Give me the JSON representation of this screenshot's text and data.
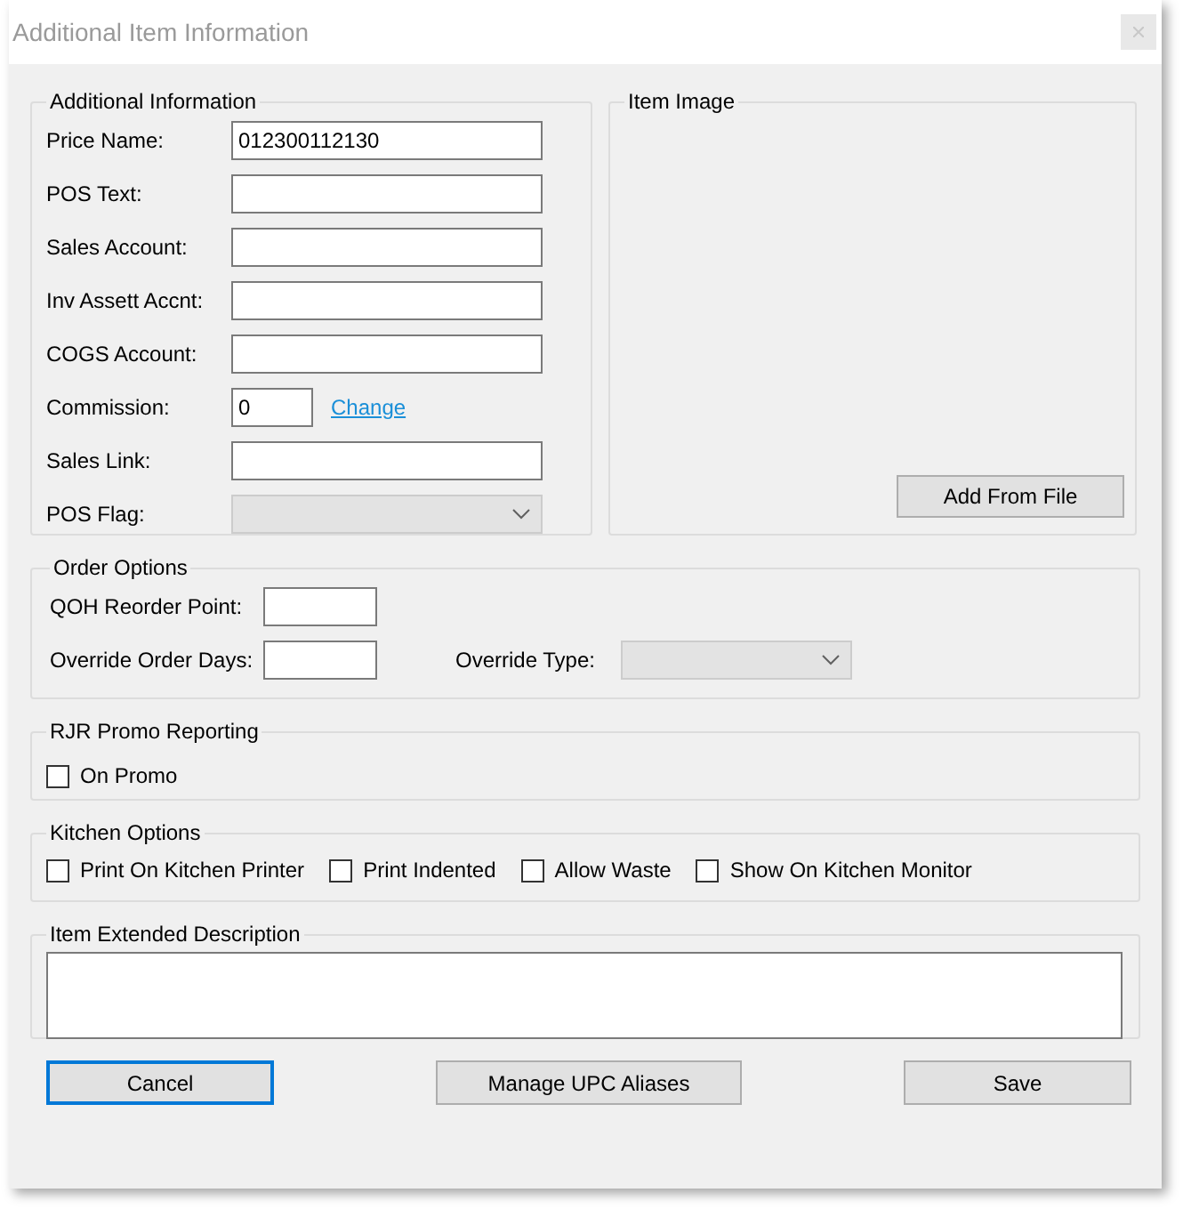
{
  "window": {
    "title": "Additional Item Information"
  },
  "additional_information": {
    "title": "Additional Information",
    "fields": [
      {
        "kind": "text",
        "label": "Price Name:",
        "value": "012300112130"
      },
      {
        "kind": "text",
        "label": "POS Text:"
      },
      {
        "kind": "text",
        "label": "Sales Account:"
      },
      {
        "kind": "text",
        "label": "Inv Assett Accnt:"
      },
      {
        "kind": "text",
        "label": "COGS Account:"
      },
      {
        "kind": "commission",
        "label": "Commission:",
        "value": "0",
        "link": "Change"
      },
      {
        "kind": "text",
        "label": "Sales Link:"
      },
      {
        "kind": "combo",
        "label": "POS Flag:",
        "disabled": true
      }
    ]
  },
  "item_image": {
    "title": "Item Image",
    "button": "Add From File"
  },
  "order_options": {
    "title": "Order Options",
    "qoh_label": "QOH Reorder Point:",
    "days_label": "Override Order Days:",
    "type_label": "Override Type:",
    "type_disabled": true
  },
  "rjr_promo": {
    "title": "RJR Promo Reporting",
    "options": [
      {
        "label": "On Promo",
        "checked": false
      }
    ]
  },
  "kitchen_options": {
    "title": "Kitchen Options",
    "options": [
      {
        "label": "Print On Kitchen Printer",
        "checked": false
      },
      {
        "label": "Print Indented",
        "checked": false
      },
      {
        "label": "Allow Waste",
        "checked": false
      },
      {
        "label": "Show On Kitchen Monitor",
        "checked": false
      }
    ]
  },
  "extended_description": {
    "title": "Item Extended Description"
  },
  "buttons": [
    {
      "label": "Cancel",
      "focused": true
    },
    {
      "label": "Manage UPC Aliases",
      "focused": false
    },
    {
      "label": "Save",
      "focused": false
    }
  ]
}
